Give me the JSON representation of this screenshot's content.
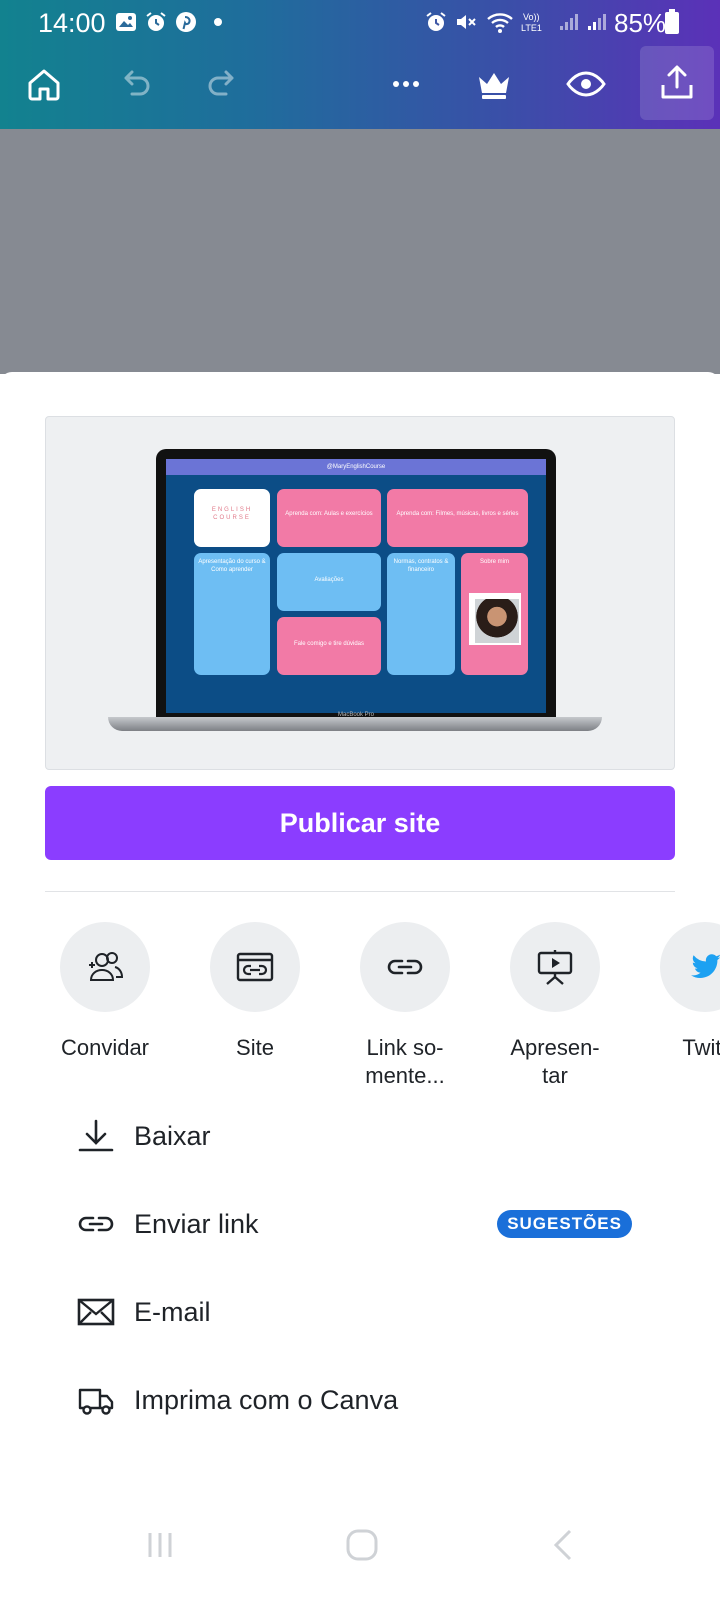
{
  "status_bar": {
    "time": "14:00",
    "battery": "85%",
    "icons": [
      "gallery-icon",
      "alarm-icon",
      "pinterest-icon",
      "dot-icon",
      "alarm-icon",
      "mute-icon",
      "wifi-icon",
      "volte-icon",
      "signal-icon",
      "signal-icon",
      "battery-icon"
    ]
  },
  "toolbar": {
    "icons": [
      "home-icon",
      "undo-icon",
      "redo-icon",
      "more-icon",
      "crown-icon",
      "eye-icon",
      "share-icon"
    ]
  },
  "preview": {
    "screen_header": "@MaryEnglishCourse",
    "laptop_label": "MacBook Pro",
    "tiles": {
      "english_course": "ENGLISH COURSE",
      "aulas": "Aprenda com: Aulas e exercícios",
      "filmes": "Aprenda com: Filmes, músicas, livros e séries",
      "apresentacao": "Apresentação do curso & Como aprender",
      "avaliacoes": "Avaliações",
      "normas": "Normas, contratos & financeiro",
      "sobre_mim": "Sobre mim",
      "fale": "Fale comigo e tire dúvidas"
    }
  },
  "publish_button": "Publicar site",
  "share_options": [
    {
      "label": "Convidar",
      "icon": "invite-people-icon"
    },
    {
      "label": "Site",
      "icon": "website-icon"
    },
    {
      "label": "Link so-\nmente...",
      "icon": "link-icon"
    },
    {
      "label": "Apresen-\ntar",
      "icon": "present-icon"
    },
    {
      "label": "Twitt",
      "icon": "twitter-icon"
    }
  ],
  "menu": [
    {
      "label": "Baixar",
      "icon": "download-icon"
    },
    {
      "label": "Enviar link",
      "icon": "link-icon",
      "badge": "SUGESTÕES"
    },
    {
      "label": "E-mail",
      "icon": "email-icon"
    },
    {
      "label": "Imprima com o Canva",
      "icon": "truck-icon"
    }
  ],
  "nav_bar": {
    "icons": [
      "recents-icon",
      "home-nav-icon",
      "back-icon"
    ]
  },
  "colors": {
    "brand_purple": "#8b3dff",
    "badge_blue": "#1a6fd9",
    "toolbar_gradient_start": "#12828f",
    "toolbar_gradient_end": "#5b31b8"
  }
}
